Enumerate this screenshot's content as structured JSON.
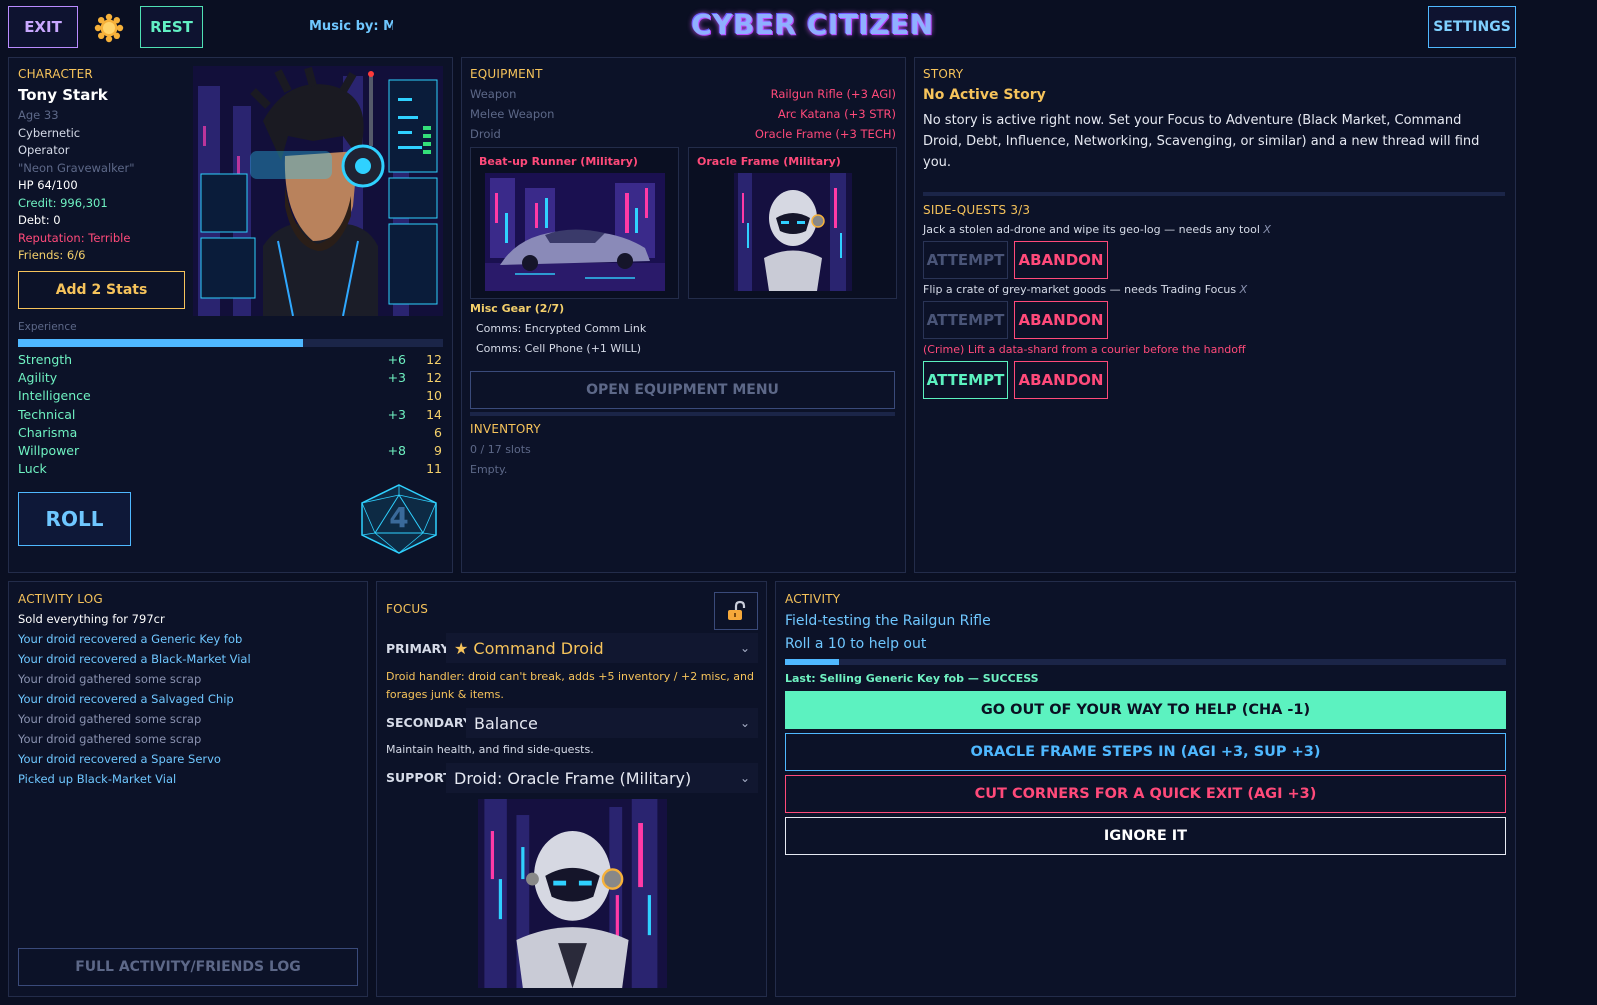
{
  "topbar": {
    "exit_label": "EXIT",
    "rest_label": "REST",
    "music_text": "Music by: Mon",
    "game_title": "CYBER CITIZEN",
    "settings_label": "SETTINGS"
  },
  "character": {
    "section_label": "CHARACTER",
    "name": "Tony Stark",
    "age": "Age 33",
    "class_line1": "Cybernetic",
    "class_line2": "Operator",
    "nickname": "\"Neon Gravewalker\"",
    "hp": "HP 64/100",
    "credit": "Credit: 996,301",
    "debt": "Debt: 0",
    "reputation": "Reputation: Terrible",
    "friends": "Friends: 6/6",
    "add_stats_label": "Add 2 Stats",
    "experience_label": "Experience",
    "experience_fraction": 0.67,
    "stats": [
      {
        "name": "Strength",
        "bonus": "+6",
        "value": "12"
      },
      {
        "name": "Agility",
        "bonus": "+3",
        "value": "12"
      },
      {
        "name": "Intelligence",
        "bonus": "",
        "value": "10"
      },
      {
        "name": "Technical",
        "bonus": "+3",
        "value": "14"
      },
      {
        "name": "Charisma",
        "bonus": "",
        "value": "6"
      },
      {
        "name": "Willpower",
        "bonus": "+8",
        "value": "9"
      },
      {
        "name": "Luck",
        "bonus": "",
        "value": "11"
      }
    ],
    "roll_label": "ROLL",
    "die_value": "4"
  },
  "equipment": {
    "section_label": "EQUIPMENT",
    "slots": [
      {
        "slot": "Weapon",
        "item": "Railgun Rifle  (+3 AGI)"
      },
      {
        "slot": "Melee Weapon",
        "item": "Arc Katana  (+3 STR)"
      },
      {
        "slot": "Droid",
        "item": "Oracle Frame  (+3 TECH)"
      }
    ],
    "vehicle_card": "Beat-up Runner (Military)",
    "droid_card": "Oracle Frame (Military)",
    "misc_label": "Misc Gear (2/7)",
    "misc_items": [
      "Comms: Encrypted Comm Link",
      "Comms: Cell Phone  (+1 WILL)"
    ],
    "open_menu_label": "OPEN EQUIPMENT MENU",
    "inventory_label": "INVENTORY",
    "inventory_slots": "0 / 17 slots",
    "inventory_empty": "Empty."
  },
  "story": {
    "section_label": "STORY",
    "title": "No Active Story",
    "body": "No story is active right now. Set your Focus to Adventure (Black Market, Command Droid, Debt, Influence, Networking, Scavenging, or similar) and a new thread will find you.",
    "side_quests_label": "SIDE-QUESTS 3/3",
    "quests": [
      {
        "text": "Jack a stolen ad-drone and wipe its geo-log — needs any tool",
        "mark": "X"
      },
      {
        "text": "Flip a crate of grey-market goods — needs Trading Focus",
        "mark": "X"
      },
      {
        "text": "(Crime) Lift a data-shard from a courier before the handoff",
        "mark": ""
      }
    ],
    "attempt_label": "ATTEMPT",
    "abandon_label": "ABANDON"
  },
  "activity_log": {
    "section_label": "ACTIVITY LOG",
    "entries": [
      {
        "text": "Sold everything for 797cr",
        "tone": "white"
      },
      {
        "text": "Your droid recovered a Generic Key fob",
        "tone": "blue"
      },
      {
        "text": "Your droid recovered a Black-Market Vial",
        "tone": "blue"
      },
      {
        "text": "Your droid gathered some scrap",
        "tone": "grey"
      },
      {
        "text": "Your droid recovered a Salvaged Chip",
        "tone": "blue"
      },
      {
        "text": "Your droid gathered some scrap",
        "tone": "grey"
      },
      {
        "text": "Your droid gathered some scrap",
        "tone": "grey"
      },
      {
        "text": "Your droid recovered a Spare Servo",
        "tone": "blue"
      },
      {
        "text": "Picked up Black-Market Vial",
        "tone": "blue"
      }
    ],
    "full_log_label": "FULL ACTIVITY/FRIENDS LOG"
  },
  "focus": {
    "section_label": "FOCUS",
    "primary_label": "PRIMARY",
    "primary_value": "★ Command Droid",
    "primary_desc": "Droid handler: droid can't break, adds +5 inventory / +2 misc, and forages junk & items.",
    "secondary_label": "SECONDARY",
    "secondary_value": "Balance",
    "secondary_desc": "Maintain health, and find side-quests.",
    "support_label": "SUPPORT",
    "support_value": "Droid: Oracle Frame (Military)"
  },
  "activity": {
    "section_label": "ACTIVITY",
    "title": "Field-testing the Railgun Rifle",
    "roll_hint": "Roll a 10 to help out",
    "progress_fraction": 0.075,
    "last_result": "Last: Selling Generic Key fob — SUCCESS",
    "choices": [
      {
        "label": "GO OUT OF YOUR WAY TO HELP (CHA -1)"
      },
      {
        "label": "ORACLE FRAME STEPS IN (AGI +3, SUP +3)"
      },
      {
        "label": "CUT CORNERS FOR A QUICK EXIT (AGI +3)"
      },
      {
        "label": "IGNORE IT"
      }
    ]
  },
  "colors": {
    "accent_yellow": "#f6c35b",
    "stat_green": "#6ff2c2",
    "danger_red": "#ff4a7a",
    "info_blue": "#6fc7ff",
    "help_button": "#5cf2c0"
  }
}
